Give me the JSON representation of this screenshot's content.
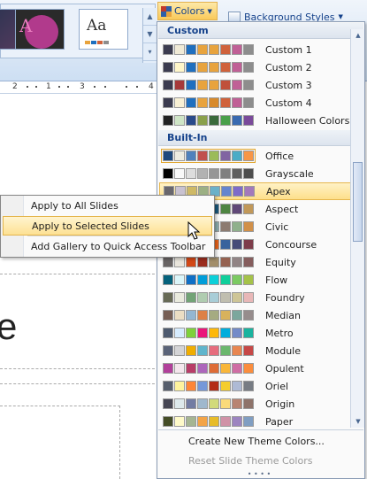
{
  "ribbon": {
    "colors_button_label": "Colors",
    "background_styles_label": "Background Styles",
    "gallery_thumbnails": [
      {
        "label": ""
      },
      {
        "label": "A"
      },
      {
        "label": "Aa"
      }
    ],
    "ruler_marks": [
      "2",
      "1",
      "3",
      "4"
    ]
  },
  "slide": {
    "partial_text": "e"
  },
  "colors_dropdown": {
    "custom_header": "Custom",
    "custom": [
      {
        "name": "Custom 1",
        "swatches": [
          "#3b3b4f",
          "#f0ead6",
          "#1f6fbf",
          "#e8a33d",
          "#e8a33d",
          "#d0623b",
          "#c06096",
          "#8d8d8d"
        ]
      },
      {
        "name": "Custom 2",
        "swatches": [
          "#3b3b4f",
          "#fff6c9",
          "#1f6fbf",
          "#e8a33d",
          "#e8a33d",
          "#d0623b",
          "#c06096",
          "#8d8d8d"
        ]
      },
      {
        "name": "Custom 3",
        "swatches": [
          "#3b3b4f",
          "#a63a3a",
          "#1f6fbf",
          "#e8a33d",
          "#e8a33d",
          "#c0503a",
          "#c06096",
          "#8d8d8d"
        ]
      },
      {
        "name": "Custom 4",
        "swatches": [
          "#3b3b4f",
          "#f8f0d4",
          "#1f6fbf",
          "#e8a33d",
          "#d88a2a",
          "#d0623b",
          "#c06096",
          "#8d8d8d"
        ]
      },
      {
        "name": "Halloween Colors",
        "swatches": [
          "#232323",
          "#cfe5c6",
          "#2a4a8a",
          "#8aa04a",
          "#3a6a3a",
          "#4aa04a",
          "#3a6ab0",
          "#7a4a9a"
        ]
      }
    ],
    "builtin_header": "Built-In",
    "builtin": [
      {
        "name": "Office",
        "swatches": [
          "#1f497d",
          "#eeece1",
          "#4f81bd",
          "#c0504d",
          "#9bbb59",
          "#8064a2",
          "#4bacc6",
          "#f79646"
        ]
      },
      {
        "name": "Grayscale",
        "swatches": [
          "#000000",
          "#f8f8f8",
          "#dddddd",
          "#b2b2b2",
          "#969696",
          "#808080",
          "#5f5f5f",
          "#4d4d4d"
        ]
      },
      {
        "name": "Apex",
        "swatches": [
          "#69676d",
          "#c9c2d1",
          "#ceb966",
          "#9cb084",
          "#6bb1c9",
          "#6585cf",
          "#7e6bc9",
          "#a379bb"
        ]
      },
      {
        "name": "Aspect",
        "swatches": [
          "#323232",
          "#e3ded1",
          "#f07f09",
          "#9f2936",
          "#1b587c",
          "#4e8542",
          "#604878",
          "#c19859"
        ]
      },
      {
        "name": "Civic",
        "swatches": [
          "#646b86",
          "#c5d1d7",
          "#d16349",
          "#ccb400",
          "#8cadae",
          "#8c7b70",
          "#8fb08c",
          "#d19049"
        ]
      },
      {
        "name": "Concourse",
        "swatches": [
          "#464646",
          "#def5fa",
          "#2da2bf",
          "#da1f28",
          "#eb641b",
          "#39639d",
          "#474b78",
          "#7d3c4a"
        ]
      },
      {
        "name": "Equity",
        "swatches": [
          "#696464",
          "#e9e5dc",
          "#d34817",
          "#9b2d1f",
          "#a28e6a",
          "#956251",
          "#918485",
          "#855d5d"
        ]
      },
      {
        "name": "Flow",
        "swatches": [
          "#04617b",
          "#dbf5f9",
          "#0f6fc6",
          "#009dd9",
          "#0bd0d9",
          "#10cf9b",
          "#7cca62",
          "#a5c249"
        ]
      },
      {
        "name": "Foundry",
        "swatches": [
          "#676a55",
          "#eaebde",
          "#72a376",
          "#b0ccb0",
          "#a8cdd7",
          "#c0beaf",
          "#cec597",
          "#e8b7b7"
        ]
      },
      {
        "name": "Median",
        "swatches": [
          "#775f55",
          "#ebddc3",
          "#94b6d2",
          "#dd8047",
          "#a5ab81",
          "#d8b25c",
          "#7ba79d",
          "#968c8c"
        ]
      },
      {
        "name": "Metro",
        "swatches": [
          "#4e5b6f",
          "#d6ecff",
          "#7fd13b",
          "#ea157a",
          "#feb80a",
          "#00addc",
          "#738ac8",
          "#1ab39f"
        ]
      },
      {
        "name": "Module",
        "swatches": [
          "#5a6378",
          "#d4d4d6",
          "#f0ad00",
          "#60b5cc",
          "#e66c7d",
          "#6bb76d",
          "#e88651",
          "#c64847"
        ]
      },
      {
        "name": "Opulent",
        "swatches": [
          "#b13f9a",
          "#f4e7ed",
          "#b83d68",
          "#ac66bb",
          "#de6c36",
          "#f9b639",
          "#cf6da4",
          "#fa8d3d"
        ]
      },
      {
        "name": "Oriel",
        "swatches": [
          "#575f6d",
          "#fff39d",
          "#fe8637",
          "#7598d9",
          "#b32c16",
          "#f5cd2d",
          "#aebad5",
          "#777c84"
        ]
      },
      {
        "name": "Origin",
        "swatches": [
          "#464653",
          "#dde9ec",
          "#727ca3",
          "#9fb8cd",
          "#d2da7a",
          "#fada7a",
          "#b88472",
          "#8e736a"
        ]
      },
      {
        "name": "Paper",
        "swatches": [
          "#444d26",
          "#fefac9",
          "#a5b592",
          "#f3a447",
          "#e7bc29",
          "#d092a7",
          "#9c85c0",
          "#809ec2"
        ]
      }
    ],
    "create_new_label": "Create New Theme Colors...",
    "reset_label": "Reset Slide Theme Colors"
  },
  "context_menu": {
    "items": [
      {
        "label": "Apply to All Slides"
      },
      {
        "label": "Apply to Selected Slides"
      },
      {
        "label": "Add Gallery to Quick Access Toolbar"
      }
    ]
  }
}
